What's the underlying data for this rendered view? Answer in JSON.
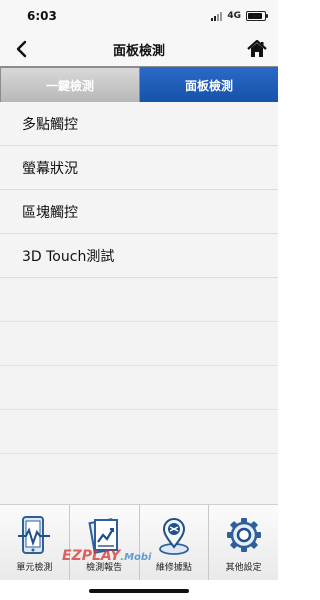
{
  "status_bar": {
    "time": "6:03",
    "network": "4G",
    "battery_level": 0.85
  },
  "nav": {
    "title": "面板檢測",
    "back_icon": "chevron-left-icon",
    "home_icon": "home-icon"
  },
  "tabs": [
    {
      "label": "一鍵檢測",
      "selected": false
    },
    {
      "label": "面板檢測",
      "selected": true
    }
  ],
  "list": {
    "items": [
      {
        "label": "多點觸控"
      },
      {
        "label": "螢幕狀況"
      },
      {
        "label": "區塊觸控"
      },
      {
        "label": "3D Touch測試"
      }
    ]
  },
  "tabbar": {
    "items": [
      {
        "label": "單元檢測",
        "icon": "phone-pulse-icon"
      },
      {
        "label": "檢測報告",
        "icon": "report-chart-icon"
      },
      {
        "label": "維修據點",
        "icon": "location-pin-icon"
      },
      {
        "label": "其他設定",
        "icon": "gear-icon"
      }
    ]
  },
  "watermark": {
    "brand": "EZPLAY",
    "suffix": ".Mobi"
  },
  "colors": {
    "accent": "#1a5cb8",
    "tab_inactive": "#c4c4c4",
    "list_bg": "#f2f2f2"
  }
}
